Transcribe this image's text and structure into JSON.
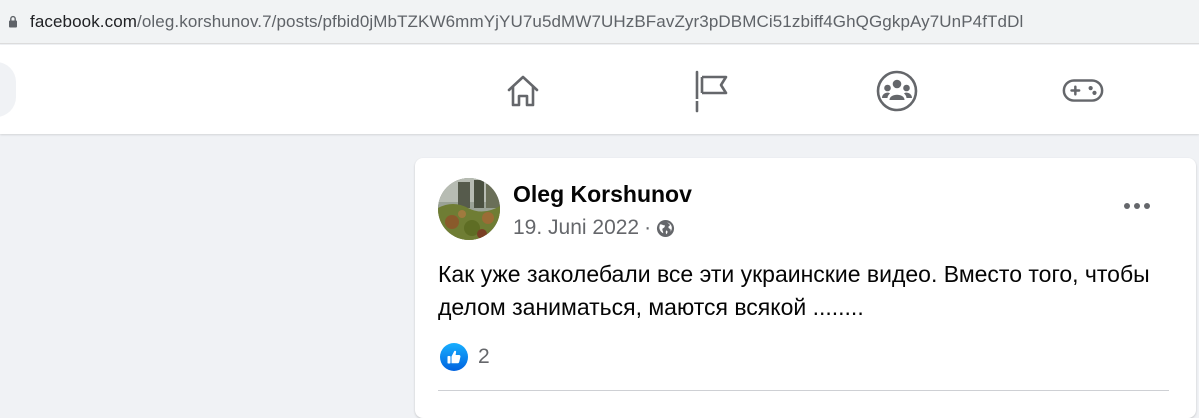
{
  "browser": {
    "url_host": "facebook.com",
    "url_path": "/oleg.korshunov.7/posts/pfbid0jMbTZKW6mmYjYU7u5dMW7UHzBFavZyr3pDBMCi51zbiff4GhQGgkpAy7UnP4fTdDl",
    "lock_icon": "lock-icon"
  },
  "topnav": {
    "icons": [
      "home-icon",
      "flag-icon",
      "groups-icon",
      "gaming-icon"
    ]
  },
  "post": {
    "author": "Oleg Korshunov",
    "date": "19. Juni 2022",
    "separator": "·",
    "audience_icon": "globe-icon",
    "text": "Как уже заколебали все эти украинские видео. Вместо того, чтобы делом заниматься, маются всякой ........",
    "reactions": {
      "icon": "like-icon",
      "count": "2"
    },
    "colors": {
      "like_blue": "#1877f2",
      "secondary_text": "#65676b"
    }
  }
}
